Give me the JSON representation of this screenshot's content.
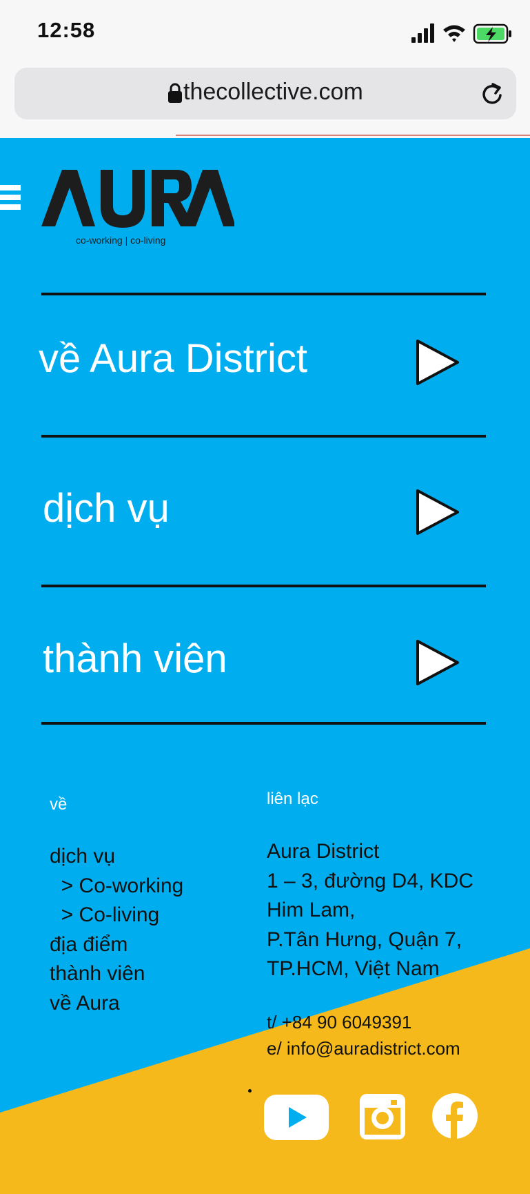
{
  "status_bar": {
    "time": "12:58",
    "icons": [
      "signal-icon",
      "wifi-icon",
      "battery-charging-icon"
    ]
  },
  "browser": {
    "url": "thecollective.com",
    "icons": [
      "lock-icon",
      "reload-icon"
    ]
  },
  "colors": {
    "page_bg": "#00aeef",
    "accent_yellow": "#f5b91b",
    "text_dark": "#111111",
    "text_light": "#ffffff"
  },
  "logo": {
    "tagline": "co-working  |  co-living"
  },
  "menu": {
    "items": [
      {
        "label": "về Aura District"
      },
      {
        "label": "dịch vụ"
      },
      {
        "label": "thành viên"
      }
    ]
  },
  "footer": {
    "left_heading": "về",
    "links": [
      "dịch vụ",
      "  > Co-working",
      "  > Co-living",
      "địa điểm",
      "thành viên",
      "về Aura"
    ],
    "right_heading": "liên lạc",
    "address": [
      "Aura District",
      "1 – 3, đường D4, KDC",
      "Him Lam,",
      "P.Tân Hưng, Quận 7,",
      "TP.HCM, Việt Nam"
    ],
    "phone": "t/ +84 90 6049391",
    "email": "e/ info@auradistrict.com",
    "social": [
      "youtube-icon",
      "instagram-icon",
      "facebook-icon"
    ]
  }
}
